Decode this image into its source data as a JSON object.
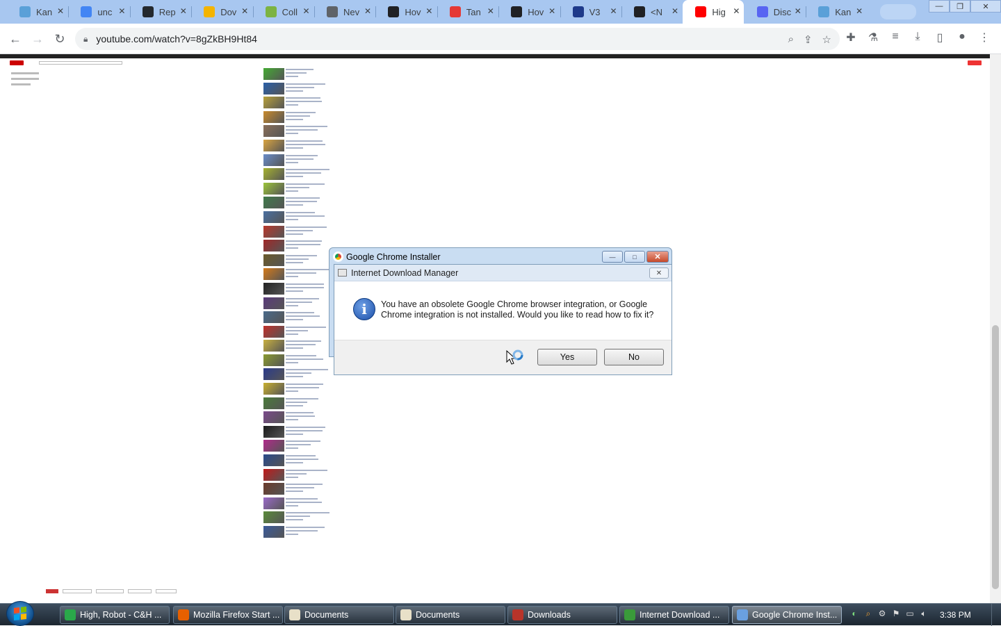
{
  "browser": {
    "tabs": [
      {
        "title": "Kan",
        "favicon_color": "#5aa0d8",
        "active": false
      },
      {
        "title": "unc",
        "favicon_color": "#4285f4",
        "active": false
      },
      {
        "title": "Rep",
        "favicon_color": "#24292e",
        "active": false
      },
      {
        "title": "Dov",
        "favicon_color": "#f4b400",
        "active": false
      },
      {
        "title": "Coll",
        "favicon_color": "#7cb342",
        "active": false
      },
      {
        "title": "Nev",
        "favicon_color": "#5f6368",
        "active": false
      },
      {
        "title": "Hov",
        "favicon_color": "#202124",
        "active": false
      },
      {
        "title": "Tan",
        "favicon_color": "#e53935",
        "active": false
      },
      {
        "title": "Hov",
        "favicon_color": "#202124",
        "active": false
      },
      {
        "title": "V3",
        "favicon_color": "#1e3a8a",
        "active": false
      },
      {
        "title": "<N",
        "favicon_color": "#202124",
        "active": false
      },
      {
        "title": "Hig",
        "favicon_color": "#ff0000",
        "active": true
      },
      {
        "title": "Disc",
        "favicon_color": "#5865f2",
        "active": false
      },
      {
        "title": "Kan",
        "favicon_color": "#5aa0d8",
        "active": false
      }
    ],
    "url": "youtube.com/watch?v=8gZkBH9Ht84"
  },
  "video_list_colors": [
    "#4a3",
    "#2a5fa8",
    "#b7a03a",
    "#c98a2c",
    "#8a6f5a",
    "#d9a441",
    "#6a8cc8",
    "#a5b230",
    "#9bc43a",
    "#3f7a4a",
    "#4a6fa0",
    "#b9372b",
    "#a02828",
    "#6b5a2a",
    "#d47a1a",
    "#222",
    "#5a3a7a",
    "#4a6a8a",
    "#c0302a",
    "#c8b040",
    "#8a9a30",
    "#2a3a8a",
    "#c8b030",
    "#4a7a3a",
    "#7a4a8a",
    "#1a1a1a",
    "#b02a8a",
    "#2a4a8a",
    "#c01a1a",
    "#6a3a2a",
    "#9a6ac8",
    "#5a8a3a",
    "#3a5a9a"
  ],
  "dialog_back": {
    "title": "Google Chrome Installer",
    "buttons": {
      "minimize": "—",
      "maximize": "□",
      "close": "✕"
    }
  },
  "dialog": {
    "title": "Internet Download Manager",
    "close": "✕",
    "message": "You have an obsolete Google Chrome browser integration, or Google Chrome integration is not installed. Would you like to read how to fix it?",
    "yes_label": "Yes",
    "no_label": "No"
  },
  "taskbar": {
    "items": [
      {
        "label": "High, Robot - C&H ...",
        "icon_color": "#2aa84a",
        "active": false
      },
      {
        "label": "Mozilla Firefox Start ...",
        "icon_color": "#e66000",
        "active": false
      },
      {
        "label": "Documents",
        "icon_color": "#e8e0c8",
        "active": false
      },
      {
        "label": "Documents",
        "icon_color": "#e8e0c8",
        "active": false
      },
      {
        "label": "Downloads",
        "icon_color": "#b8342a",
        "active": false
      },
      {
        "label": "Internet Download ...",
        "icon_color": "#3a9a3a",
        "active": false
      },
      {
        "label": "Google Chrome Inst...",
        "icon_color": "#6aa0e0",
        "active": true
      }
    ],
    "clock": "3:38 PM"
  }
}
